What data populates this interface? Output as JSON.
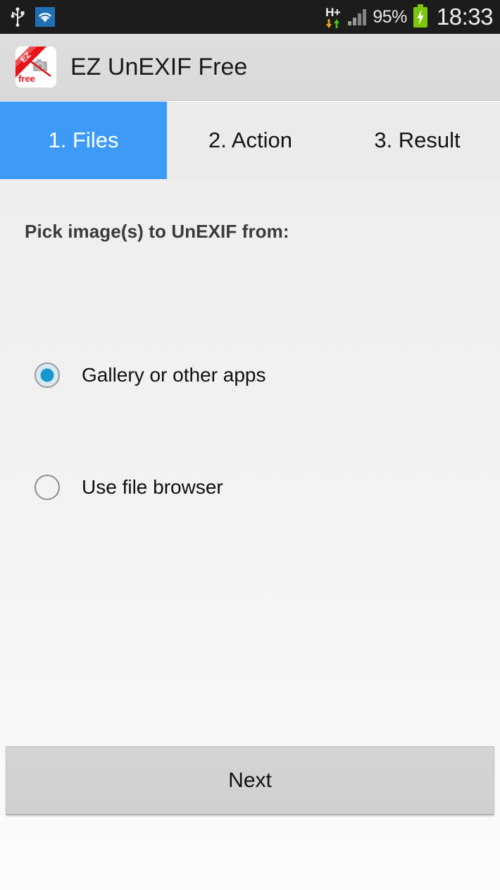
{
  "status_bar": {
    "left_icons": [
      {
        "name": "usb-icon",
        "label": "USB"
      },
      {
        "name": "wifi-icon",
        "label": "Wi-Fi"
      }
    ],
    "network_type": "H+",
    "battery_percent": "95%",
    "time": "18:33",
    "signal_icon": "signal-bars-icon",
    "battery_icon": "battery-charging-icon",
    "colors": {
      "background": "#1c1c1c",
      "text": "#f0f0f0",
      "battery_green": "#7ac70c",
      "wifi_blue": "#1f6fb5"
    }
  },
  "action_bar": {
    "app_title": "EZ UnEXIF Free",
    "icon_name": "app-logo-icon",
    "icon_text_top": "EZ",
    "icon_text_bottom": "free",
    "colors": {
      "background": "#dedede",
      "title_text": "#1a1a1a",
      "logo_red": "#e8131a"
    }
  },
  "tabs": {
    "items": [
      {
        "label": "1. Files",
        "active": true
      },
      {
        "label": "2. Action",
        "active": false
      },
      {
        "label": "3. Result",
        "active": false
      }
    ],
    "colors": {
      "active_background": "#3d9bf7",
      "active_text": "#ffffff",
      "inactive_background": "#ebebeb",
      "inactive_text": "#141414"
    }
  },
  "main": {
    "prompt": "Pick image(s) to UnEXIF from:",
    "radio_options": [
      {
        "label": "Gallery or other apps",
        "selected": true
      },
      {
        "label": "Use file browser",
        "selected": false
      }
    ],
    "radio_selected_color": "#1797cf"
  },
  "footer": {
    "next_label": "Next"
  }
}
